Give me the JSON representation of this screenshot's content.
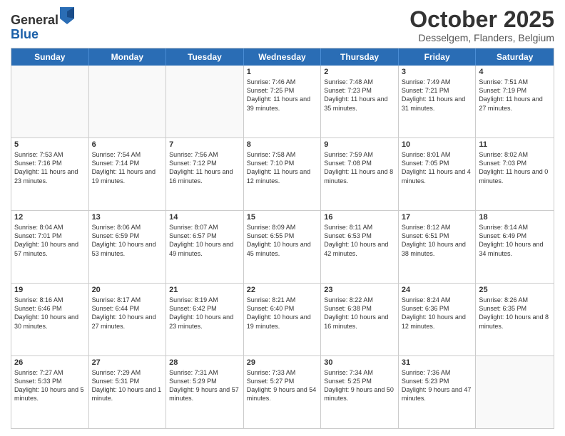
{
  "logo": {
    "general": "General",
    "blue": "Blue"
  },
  "title": "October 2025",
  "location": "Desselgem, Flanders, Belgium",
  "days": [
    "Sunday",
    "Monday",
    "Tuesday",
    "Wednesday",
    "Thursday",
    "Friday",
    "Saturday"
  ],
  "rows": [
    [
      {
        "day": "",
        "text": ""
      },
      {
        "day": "",
        "text": ""
      },
      {
        "day": "",
        "text": ""
      },
      {
        "day": "1",
        "text": "Sunrise: 7:46 AM\nSunset: 7:25 PM\nDaylight: 11 hours and 39 minutes."
      },
      {
        "day": "2",
        "text": "Sunrise: 7:48 AM\nSunset: 7:23 PM\nDaylight: 11 hours and 35 minutes."
      },
      {
        "day": "3",
        "text": "Sunrise: 7:49 AM\nSunset: 7:21 PM\nDaylight: 11 hours and 31 minutes."
      },
      {
        "day": "4",
        "text": "Sunrise: 7:51 AM\nSunset: 7:19 PM\nDaylight: 11 hours and 27 minutes."
      }
    ],
    [
      {
        "day": "5",
        "text": "Sunrise: 7:53 AM\nSunset: 7:16 PM\nDaylight: 11 hours and 23 minutes."
      },
      {
        "day": "6",
        "text": "Sunrise: 7:54 AM\nSunset: 7:14 PM\nDaylight: 11 hours and 19 minutes."
      },
      {
        "day": "7",
        "text": "Sunrise: 7:56 AM\nSunset: 7:12 PM\nDaylight: 11 hours and 16 minutes."
      },
      {
        "day": "8",
        "text": "Sunrise: 7:58 AM\nSunset: 7:10 PM\nDaylight: 11 hours and 12 minutes."
      },
      {
        "day": "9",
        "text": "Sunrise: 7:59 AM\nSunset: 7:08 PM\nDaylight: 11 hours and 8 minutes."
      },
      {
        "day": "10",
        "text": "Sunrise: 8:01 AM\nSunset: 7:05 PM\nDaylight: 11 hours and 4 minutes."
      },
      {
        "day": "11",
        "text": "Sunrise: 8:02 AM\nSunset: 7:03 PM\nDaylight: 11 hours and 0 minutes."
      }
    ],
    [
      {
        "day": "12",
        "text": "Sunrise: 8:04 AM\nSunset: 7:01 PM\nDaylight: 10 hours and 57 minutes."
      },
      {
        "day": "13",
        "text": "Sunrise: 8:06 AM\nSunset: 6:59 PM\nDaylight: 10 hours and 53 minutes."
      },
      {
        "day": "14",
        "text": "Sunrise: 8:07 AM\nSunset: 6:57 PM\nDaylight: 10 hours and 49 minutes."
      },
      {
        "day": "15",
        "text": "Sunrise: 8:09 AM\nSunset: 6:55 PM\nDaylight: 10 hours and 45 minutes."
      },
      {
        "day": "16",
        "text": "Sunrise: 8:11 AM\nSunset: 6:53 PM\nDaylight: 10 hours and 42 minutes."
      },
      {
        "day": "17",
        "text": "Sunrise: 8:12 AM\nSunset: 6:51 PM\nDaylight: 10 hours and 38 minutes."
      },
      {
        "day": "18",
        "text": "Sunrise: 8:14 AM\nSunset: 6:49 PM\nDaylight: 10 hours and 34 minutes."
      }
    ],
    [
      {
        "day": "19",
        "text": "Sunrise: 8:16 AM\nSunset: 6:46 PM\nDaylight: 10 hours and 30 minutes."
      },
      {
        "day": "20",
        "text": "Sunrise: 8:17 AM\nSunset: 6:44 PM\nDaylight: 10 hours and 27 minutes."
      },
      {
        "day": "21",
        "text": "Sunrise: 8:19 AM\nSunset: 6:42 PM\nDaylight: 10 hours and 23 minutes."
      },
      {
        "day": "22",
        "text": "Sunrise: 8:21 AM\nSunset: 6:40 PM\nDaylight: 10 hours and 19 minutes."
      },
      {
        "day": "23",
        "text": "Sunrise: 8:22 AM\nSunset: 6:38 PM\nDaylight: 10 hours and 16 minutes."
      },
      {
        "day": "24",
        "text": "Sunrise: 8:24 AM\nSunset: 6:36 PM\nDaylight: 10 hours and 12 minutes."
      },
      {
        "day": "25",
        "text": "Sunrise: 8:26 AM\nSunset: 6:35 PM\nDaylight: 10 hours and 8 minutes."
      }
    ],
    [
      {
        "day": "26",
        "text": "Sunrise: 7:27 AM\nSunset: 5:33 PM\nDaylight: 10 hours and 5 minutes."
      },
      {
        "day": "27",
        "text": "Sunrise: 7:29 AM\nSunset: 5:31 PM\nDaylight: 10 hours and 1 minute."
      },
      {
        "day": "28",
        "text": "Sunrise: 7:31 AM\nSunset: 5:29 PM\nDaylight: 9 hours and 57 minutes."
      },
      {
        "day": "29",
        "text": "Sunrise: 7:33 AM\nSunset: 5:27 PM\nDaylight: 9 hours and 54 minutes."
      },
      {
        "day": "30",
        "text": "Sunrise: 7:34 AM\nSunset: 5:25 PM\nDaylight: 9 hours and 50 minutes."
      },
      {
        "day": "31",
        "text": "Sunrise: 7:36 AM\nSunset: 5:23 PM\nDaylight: 9 hours and 47 minutes."
      },
      {
        "day": "",
        "text": ""
      }
    ]
  ]
}
